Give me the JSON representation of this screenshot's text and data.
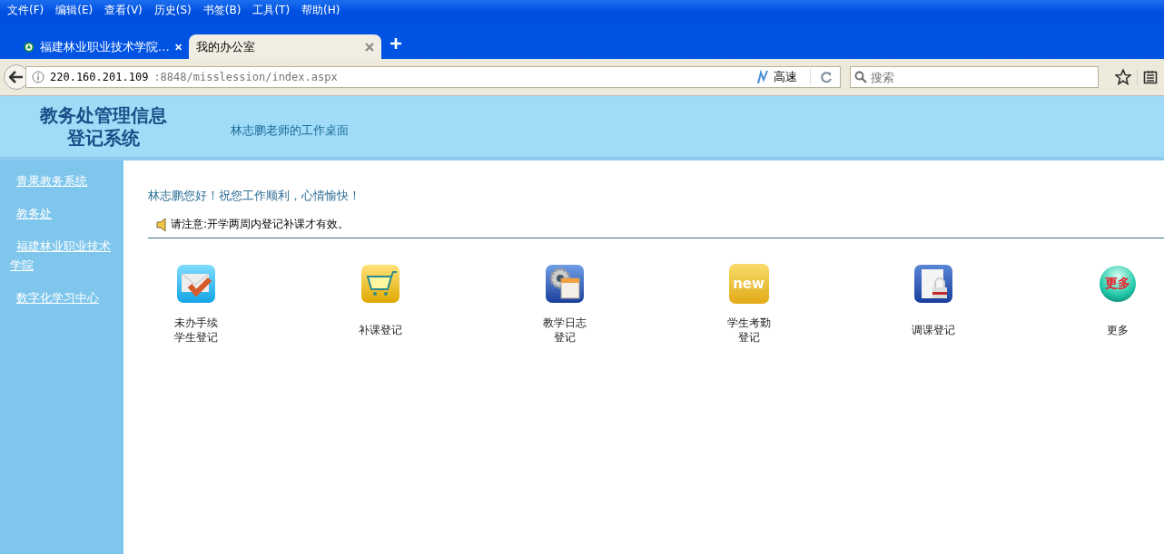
{
  "menu_bar": [
    "文件(F)",
    "编辑(E)",
    "查看(V)",
    "历史(S)",
    "书签(B)",
    "工具(T)",
    "帮助(H)"
  ],
  "tabs": [
    {
      "title": "福建林业职业技术学院…",
      "selected": false,
      "has_favicon": true
    },
    {
      "title": "我的办公室",
      "selected": true,
      "has_favicon": false
    }
  ],
  "address_bar": {
    "host": "220.160.201.109",
    "rest": ":8848/misslession/index.aspx",
    "speed_label": "高速"
  },
  "search": {
    "placeholder": "搜索"
  },
  "header": {
    "title_line_1": "教务处管理信息",
    "title_line_2": "登记系统",
    "subtitle": "林志鹏老师的工作桌面"
  },
  "sidebar": {
    "items": [
      {
        "label": "青果教务系统"
      },
      {
        "label": "教务处"
      },
      {
        "label": "福建林业职业技术学院"
      },
      {
        "label": "数字化学习中心"
      }
    ]
  },
  "greeting": "林志鹏您好！祝您工作顺利，心情愉快！",
  "notice": "请注意:开学两周内登记补课才有效。",
  "apps": [
    {
      "kind": "envelope",
      "label": "未办手续学生登记"
    },
    {
      "kind": "cart",
      "label": "补课登记"
    },
    {
      "kind": "gear",
      "label": "教学日志登记"
    },
    {
      "kind": "new",
      "icon_text": "new",
      "label": "学生考勤登记"
    },
    {
      "kind": "lock",
      "label": "调课登记"
    },
    {
      "kind": "more",
      "icon_text": "更多",
      "label": "更多"
    }
  ]
}
